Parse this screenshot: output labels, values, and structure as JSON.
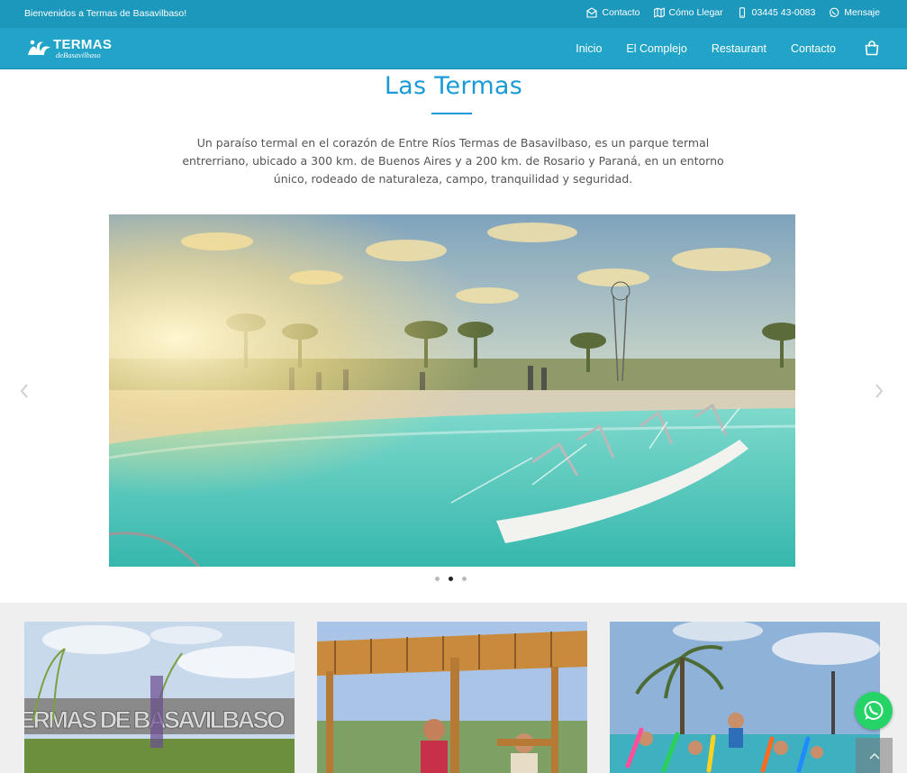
{
  "topbar": {
    "welcome": "Bienvenidos a Termas de Basavilbaso!",
    "links": [
      {
        "icon": "envelope-icon",
        "label": "Contacto"
      },
      {
        "icon": "map-icon",
        "label": "Cómo Llegar"
      },
      {
        "icon": "phone-icon",
        "label": "03445 43-0083"
      },
      {
        "icon": "whatsapp-icon",
        "label": "Mensaje"
      }
    ]
  },
  "header": {
    "logo": {
      "brand": "TERMAS",
      "sub": "deBasavilbaso"
    },
    "nav": [
      "Inicio",
      "El Complejo",
      "Restaurant",
      "Contacto"
    ],
    "cart_icon": "shopping-bag-icon"
  },
  "intro": {
    "title": "Las Termas",
    "text": "Un paraíso termal en el corazón de Entre Ríos Termas de Basavilbaso, es un parque termal entrerriano, ubicado a 300 km. de Buenos Aires y a 200 km. de Rosario y Paraná, en un entorno único, rodeado de naturaleza, campo, tranquilidad y seguridad."
  },
  "slider": {
    "slide_count": 3,
    "active_slide": 2,
    "prev_icon": "chevron-left-icon",
    "next_icon": "chevron-right-icon"
  },
  "gallery": {
    "sign_text": "ERMAS DE BASAVILBASO"
  },
  "colors": {
    "topbar": "#1b98bc",
    "header": "#21a4c8",
    "accent": "#1a9bd7",
    "whatsapp": "#25d366"
  }
}
